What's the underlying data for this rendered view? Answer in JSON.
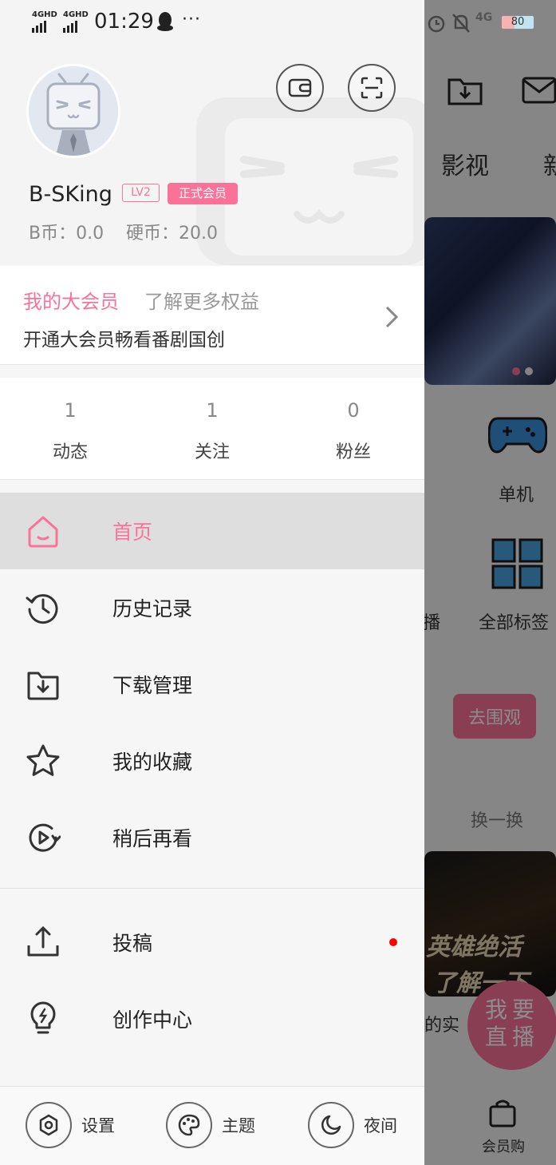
{
  "status_bar": {
    "signal_1": "4GHD",
    "signal_2": "4GHD",
    "time": "01:29",
    "more": "···",
    "network": "4G",
    "battery": "80"
  },
  "profile": {
    "username": "B-SKing",
    "level": "LV2",
    "member_tag": "正式会员",
    "coins_text": "B币：0.0    硬币：20.0"
  },
  "vip": {
    "title": "我的大会员",
    "more": "了解更多权益",
    "desc": "开通大会员畅看番剧国创"
  },
  "stats": [
    {
      "value": "1",
      "label": "动态"
    },
    {
      "value": "1",
      "label": "关注"
    },
    {
      "value": "0",
      "label": "粉丝"
    }
  ],
  "menu": [
    {
      "label": "首页",
      "icon": "home-icon",
      "active": true
    },
    {
      "label": "历史记录",
      "icon": "history-icon"
    },
    {
      "label": "下载管理",
      "icon": "download-folder-icon"
    },
    {
      "label": "我的收藏",
      "icon": "star-icon"
    },
    {
      "label": "稍后再看",
      "icon": "watch-later-icon"
    },
    {
      "label": "投稿",
      "icon": "upload-icon",
      "badge": "red-dot"
    },
    {
      "label": "创作中心",
      "icon": "lightbulb-icon"
    }
  ],
  "bottom_bar": {
    "settings": "设置",
    "theme": "主题",
    "night": "夜间"
  },
  "background": {
    "tab_partial": "影视",
    "tab_cut": "新",
    "label_single": "单机",
    "label_broadcast": "播",
    "label_all_tags": "全部标签",
    "btn_watch": "去围观",
    "refresh": "换一换",
    "card_line1": "英雄绝活",
    "card_line2": "了解一下",
    "card_caption": "的实",
    "live_line1": "我要",
    "live_line2": "直播",
    "shop": "会员购"
  },
  "colors": {
    "accent": "#fb7299",
    "badge_red": "#ff0000"
  }
}
